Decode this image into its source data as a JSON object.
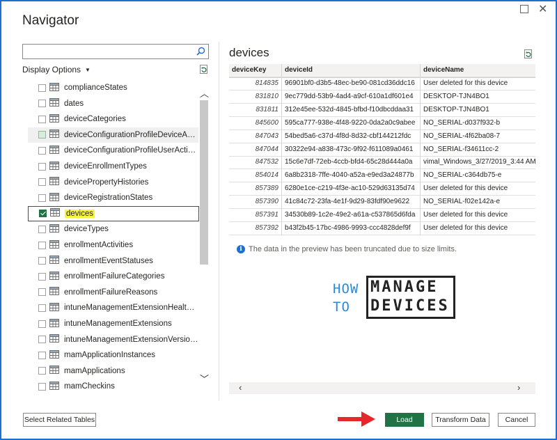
{
  "dialog": {
    "title": "Navigator"
  },
  "left_pane": {
    "search": {
      "value": "",
      "placeholder": ""
    },
    "display_options": "Display Options",
    "items": [
      {
        "label": "complianceStates",
        "state": "unchecked"
      },
      {
        "label": "dates",
        "state": "unchecked"
      },
      {
        "label": "deviceCategories",
        "state": "unchecked"
      },
      {
        "label": "deviceConfigurationProfileDeviceActivi...",
        "state": "partial"
      },
      {
        "label": "deviceConfigurationProfileUserActivities",
        "state": "unchecked"
      },
      {
        "label": "deviceEnrollmentTypes",
        "state": "unchecked"
      },
      {
        "label": "devicePropertyHistories",
        "state": "unchecked"
      },
      {
        "label": "deviceRegistrationStates",
        "state": "unchecked"
      },
      {
        "label": "devices",
        "state": "checked"
      },
      {
        "label": "deviceTypes",
        "state": "unchecked"
      },
      {
        "label": "enrollmentActivities",
        "state": "unchecked"
      },
      {
        "label": "enrollmentEventStatuses",
        "state": "unchecked"
      },
      {
        "label": "enrollmentFailureCategories",
        "state": "unchecked"
      },
      {
        "label": "enrollmentFailureReasons",
        "state": "unchecked"
      },
      {
        "label": "intuneManagementExtensionHealthSta...",
        "state": "unchecked"
      },
      {
        "label": "intuneManagementExtensions",
        "state": "unchecked"
      },
      {
        "label": "intuneManagementExtensionVersions",
        "state": "unchecked"
      },
      {
        "label": "mamApplicationInstances",
        "state": "unchecked"
      },
      {
        "label": "mamApplications",
        "state": "unchecked"
      },
      {
        "label": "mamCheckins",
        "state": "unchecked"
      }
    ]
  },
  "preview": {
    "title": "devices",
    "columns": [
      "deviceKey",
      "deviceId",
      "deviceName"
    ],
    "rows": [
      [
        "814835",
        "96901bf0-d3b5-48ec-be90-081cd36ddc16",
        "User deleted for this device"
      ],
      [
        "831810",
        "9ec779dd-53b9-4ad4-a9cf-610a1df601e4",
        "DESKTOP-TJN4BO1"
      ],
      [
        "831811",
        "312e45ee-532d-4845-bfbd-f10dbcddaa31",
        "DESKTOP-TJN4BO1"
      ],
      [
        "845600",
        "595ca777-938e-4f48-9220-0da2a0c9abee",
        "NO_SERIAL-d037f932-b"
      ],
      [
        "847043",
        "54bed5a6-c37d-4f8d-8d32-cbf144212fdc",
        "NO_SERIAL-4f62ba08-7"
      ],
      [
        "847044",
        "30322e94-a838-473c-9f92-f611089a0461",
        "NO_SERIAL-f34611cc-2"
      ],
      [
        "847532",
        "15c6e7df-72eb-4ccb-bfd4-65c28d444a0a",
        "vimal_Windows_3/27/2019_3:44 AM"
      ],
      [
        "854014",
        "6a8b2318-7ffe-4040-a52a-e9ed3a24877b",
        "NO_SERIAL-c364db75-e"
      ],
      [
        "857389",
        "6280e1ce-c219-4f3e-ac10-529d63135d74",
        "User deleted for this device"
      ],
      [
        "857390",
        "41c84c72-23fa-4e1f-9d29-83fdf90e9622",
        "NO_SERIAL-f02e142a-e"
      ],
      [
        "857391",
        "34530b89-1c2e-49e2-a61a-c537865d6fda",
        "User deleted for this device"
      ],
      [
        "857392",
        "b43f2b45-17bc-4986-9993-ccc4828def9f",
        "User deleted for this device"
      ]
    ],
    "truncation_note": "The data in the preview has been truncated due to size limits."
  },
  "logo": {
    "line1": "HOW",
    "line2": "TO",
    "word1": "MANAGE",
    "word2": "DEVICES"
  },
  "footer": {
    "select_related": "Select Related Tables",
    "load": "Load",
    "transform": "Transform Data",
    "cancel": "Cancel"
  },
  "colors": {
    "accent_green": "#217346",
    "highlight": "#f8f53a",
    "arrow_red": "#e8272b"
  }
}
